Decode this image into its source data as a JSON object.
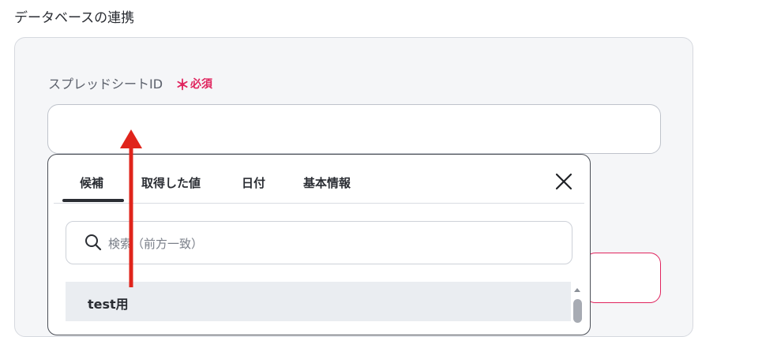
{
  "section": {
    "title": "データベースの連携"
  },
  "field": {
    "label": "スプレッドシートID",
    "required_mark": "＊",
    "required_text": "必須",
    "value": ""
  },
  "popover": {
    "tabs": [
      {
        "label": "候補",
        "active": true
      },
      {
        "label": "取得した値",
        "active": false
      },
      {
        "label": "日付",
        "active": false
      },
      {
        "label": "基本情報",
        "active": false
      }
    ],
    "search": {
      "placeholder": "検索（前方一致）"
    },
    "items": [
      {
        "label": "test用"
      }
    ]
  },
  "colors": {
    "accent_required": "#e0245e",
    "annotation_arrow": "#e0241b",
    "panel_bg": "#f5f6f8",
    "selected_row_bg": "#eaedf1"
  },
  "icons": {
    "close": "close-icon",
    "search": "search-icon",
    "scroll_up": "chevron-up-icon"
  }
}
